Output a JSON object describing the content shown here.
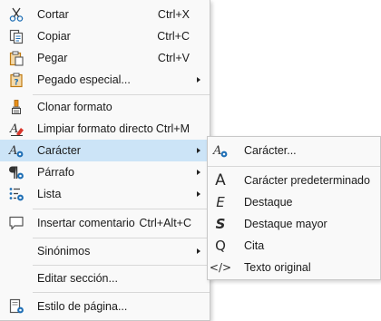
{
  "context_menu": {
    "items": [
      {
        "label": "Cortar",
        "accel": "Ctrl+X"
      },
      {
        "label": "Copiar",
        "accel": "Ctrl+C"
      },
      {
        "label": "Pegar",
        "accel": "Ctrl+V"
      },
      {
        "label": "Pegado especial...",
        "accel": ""
      },
      {
        "label": "Clonar formato",
        "accel": ""
      },
      {
        "label": "Limpiar formato directo",
        "accel": "Ctrl+M"
      },
      {
        "label": "Carácter",
        "accel": ""
      },
      {
        "label": "Párrafo",
        "accel": ""
      },
      {
        "label": "Lista",
        "accel": ""
      },
      {
        "label": "Insertar comentario",
        "accel": "Ctrl+Alt+C"
      },
      {
        "label": "Sinónimos",
        "accel": ""
      },
      {
        "label": "Editar sección...",
        "accel": ""
      },
      {
        "label": "Estilo de página...",
        "accel": ""
      }
    ]
  },
  "submenu": {
    "items": [
      {
        "label": "Carácter..."
      },
      {
        "label": "Carácter predeterminado",
        "glyph": "A"
      },
      {
        "label": "Destaque",
        "glyph": "E"
      },
      {
        "label": "Destaque mayor",
        "glyph": "S"
      },
      {
        "label": "Cita",
        "glyph": "Q"
      },
      {
        "label": "Texto original",
        "glyph": "</>"
      }
    ]
  },
  "colors": {
    "highlight": "#cce4f7",
    "menu_bg": "#f9f9f9",
    "icon_blue": "#1f6fb5",
    "icon_orange": "#e8901a",
    "icon_red": "#d9362b"
  }
}
